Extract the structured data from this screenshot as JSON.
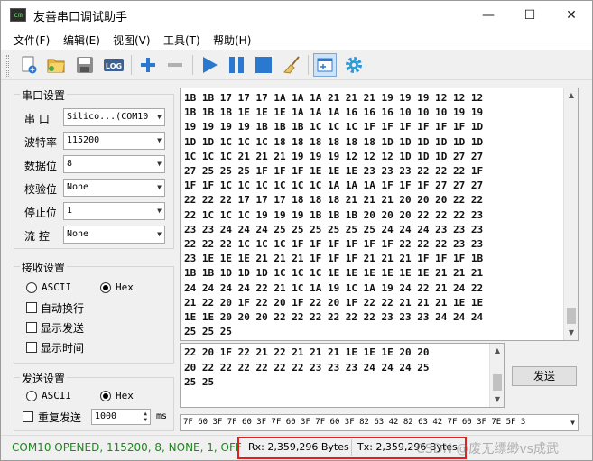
{
  "app": {
    "title": "友善串口调试助手"
  },
  "window_controls": {
    "minimize": "—",
    "maximize": "☐",
    "close": "✕"
  },
  "menu": [
    "文件(F)",
    "编辑(E)",
    "视图(V)",
    "工具(T)",
    "帮助(H)"
  ],
  "toolbar": {
    "icons": [
      "new-file-icon",
      "open-folder-icon",
      "save-icon",
      "log-icon",
      "add-icon",
      "remove-icon",
      "play-icon",
      "pause-icon",
      "stop-icon",
      "clear-broom-icon",
      "window-icon",
      "settings-gear-icon"
    ],
    "log_label": "LOG"
  },
  "serial_settings": {
    "title": "串口设置",
    "port_label": "串  口",
    "port_value": "Silico...(COM10",
    "baud_label": "波特率",
    "baud_value": "115200",
    "databits_label": "数据位",
    "databits_value": "8",
    "parity_label": "校验位",
    "parity_value": "None",
    "stopbits_label": "停止位",
    "stopbits_value": "1",
    "flow_label": "流  控",
    "flow_value": "None"
  },
  "receive_settings": {
    "title": "接收设置",
    "ascii_label": "ASCII",
    "hex_label": "Hex",
    "selected": "Hex",
    "auto_wrap": "自动换行",
    "show_send": "显示发送",
    "show_time": "显示时间"
  },
  "send_settings": {
    "title": "发送设置",
    "ascii_label": "ASCII",
    "hex_label": "Hex",
    "selected": "Hex",
    "repeat_label": "重复发送",
    "repeat_interval": "1000",
    "unit": "ms"
  },
  "rx_lines": [
    "1B 1B 17 17 17 1A 1A 1A 21 21 21 19 19 19 12 12 12",
    "1B 1B 1B 1E 1E 1E 1A 1A 1A 16 16 16 10 10 10 19 19",
    "19 19 19 19 1B 1B 1B 1C 1C 1C 1F 1F 1F 1F 1F 1F 1D",
    "1D 1D 1C 1C 1C 18 18 18 18 18 18 1D 1D 1D 1D 1D 1D",
    "1C 1C 1C 21 21 21 19 19 19 12 12 12 1D 1D 1D 27 27",
    "27 25 25 25 1F 1F 1F 1E 1E 1E 23 23 23 22 22 22 1F",
    "1F 1F 1C 1C 1C 1C 1C 1C 1A 1A 1A 1F 1F 1F 27 27 27",
    "22 22 22 17 17 17 18 18 18 21 21 21 20 20 20 22 22",
    "22 1C 1C 1C 19 19 19 1B 1B 1B 20 20 20 22 22 22 23",
    "23 23 24 24 24 25 25 25 25 25 25 24 24 24 23 23 23",
    "22 22 22 1C 1C 1C 1F 1F 1F 1F 1F 1F 22 22 22 23 23",
    "23 1E 1E 1E 21 21 21 1F 1F 1F 21 21 21 1F 1F 1F 1B",
    "1B 1B 1D 1D 1D 1C 1C 1C 1E 1E 1E 1E 1E 1E 21 21 21",
    "24 24 24 24 22 21 1C 1A 19 1C 1A 19 24 22 21 24 22",
    "21 22 20 1F 22 20 1F 22 20 1F 22 22 21 21 21 1E 1E",
    "1E 1E 20 20 20 22 22 22 22 22 22 23 23 23 24 24 24",
    "25 25 25"
  ],
  "tx_lines": [
    "22 20 1F 22 21 22 21 21 21 1E 1E 1E 20 20",
    "20 22 22 22 22 22 22 23 23 23 24 24 24 25",
    "25 25"
  ],
  "send_button": "发送",
  "command_line": "7F 60 3F 7F 60 3F 7F 60 3F 7F 60 3F 82 63 42 82 63 42 7F 60 3F 7E 5F 3",
  "status": {
    "connection": "COM10 OPENED, 115200, 8, NONE, 1, OFF",
    "rx": "Rx: 2,359,296 Bytes",
    "tx": "Tx: 2,359,296 Bytes"
  },
  "watermark": "CSDN @废无缥缈vs成武"
}
